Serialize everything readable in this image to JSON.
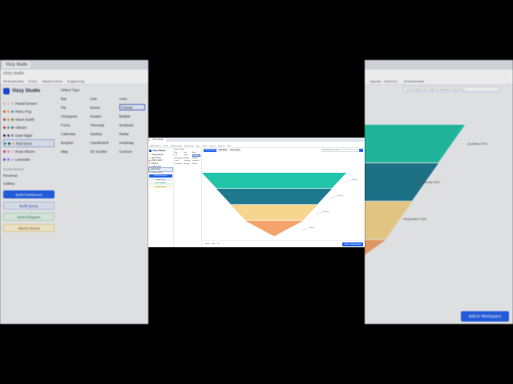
{
  "bg_left": {
    "tabs": [
      "Vizzy Studio"
    ],
    "address": "vizzy studio",
    "bookmarks": [
      "All Bookmarks",
      "El Sur",
      "Student Home",
      "Engineering"
    ],
    "app_name": "Vizzy Studio",
    "palettes": [
      {
        "label": "Pastel Dream",
        "colors": [
          "#f5b5c8",
          "#f7d9a8",
          "#b7e3c4"
        ]
      },
      {
        "label": "Retro Pop",
        "colors": [
          "#e85d4a",
          "#f2b134",
          "#3a9bd9"
        ]
      },
      {
        "label": "Warm Earth",
        "colors": [
          "#a0522d",
          "#d2a36a",
          "#6b8e23"
        ]
      },
      {
        "label": "Vibrant",
        "colors": [
          "#e6194b",
          "#3cb44b",
          "#4363d8"
        ]
      },
      {
        "label": "Dark Night",
        "colors": [
          "#1f2a44",
          "#3b4b73",
          "#7a89b8"
        ]
      },
      {
        "label": "Red Zone",
        "colors": [
          "#2a9d8f",
          "#264653",
          "#e9c46a"
        ]
      },
      {
        "label": "Rose Bloom",
        "colors": [
          "#d6336c",
          "#f783ac",
          "#fcc2d7"
        ]
      },
      {
        "label": "Lavender",
        "colors": [
          "#7048e8",
          "#9775fa",
          "#d0bfff"
        ]
      }
    ],
    "section_label": "WORKSPACE",
    "items": [
      "Revenue",
      "Gallery"
    ],
    "buttons": {
      "build": "Build Dashboard",
      "query": "Build Query",
      "diagram": "Draw Diagram",
      "report": "Sketch Board"
    },
    "controls_title": "Select Type",
    "chart_types": [
      "Bar",
      "Line",
      "Area",
      "Pie",
      "Donut",
      "Funnel",
      "Histogram",
      "Scatter",
      "Bubble",
      "Force",
      "Treemap",
      "Sunburst",
      "Calendar",
      "Sankey",
      "Radar",
      "Boxplot",
      "Candlestick",
      "Heatmap",
      "Map",
      "3D Scatter",
      "Contour"
    ],
    "selected_chart": "Funnel"
  },
  "bg_right": {
    "bookmarks": [
      "Operate - Orders to",
      "All Bookmarks"
    ],
    "search_placeholder": "Ask AI about your data or visualize in any form",
    "add_button": "Add to Workspace"
  },
  "window": {
    "tabs": [
      "Vizzy Studio"
    ],
    "bookmarks": [
      "All Bookmarks",
      "El Sur",
      "Student Home",
      "Engineering",
      "Ops",
      "Orders",
      "Finance",
      "Reports",
      "Team"
    ],
    "app_name": "Vizzy Studio",
    "palettes": [
      {
        "label": "Pastel Dream",
        "colors": [
          "#f5b5c8",
          "#f7d9a8"
        ]
      },
      {
        "label": "Retro Pop",
        "colors": [
          "#e85d4a",
          "#f2b134"
        ]
      },
      {
        "label": "Warm Earth",
        "colors": [
          "#a0522d",
          "#d2a36a"
        ]
      },
      {
        "label": "Vibrant",
        "colors": [
          "#e6194b",
          "#3cb44b"
        ]
      },
      {
        "label": "Dark Night",
        "colors": [
          "#1f2a44",
          "#3b4b73"
        ]
      },
      {
        "label": "Red Zone",
        "colors": [
          "#2a9d8f",
          "#264653"
        ]
      },
      {
        "label": "Rose Bloom",
        "colors": [
          "#d6336c",
          "#f783ac"
        ]
      }
    ],
    "buttons": {
      "build": "Build Dashboard",
      "query": "Build Query",
      "diagram": "Draw Diagram",
      "report": "Sketch Board"
    },
    "controls_title": "Select Type",
    "chart_types": [
      "Bar",
      "Line",
      "Area",
      "Pie",
      "Donut",
      "Funnel",
      "Histogram",
      "Scatter",
      "Bubble",
      "Force",
      "Treemap",
      "Sunburst",
      "Calendar",
      "Sankey",
      "Radar"
    ],
    "selected_chart": "Funnel",
    "toolbar": [
      "Funnel Chart",
      "Edit Data",
      "Insert Chart"
    ],
    "search_placeholder": "Ask AI about your data",
    "bottom": [
      "Zoom",
      "100%",
      "Fit"
    ],
    "add_button": "Add to Workspace"
  },
  "chart_data": {
    "type": "funnel",
    "stages": [
      {
        "name": "Stage 1",
        "value": 100,
        "color": "#22c4a8"
      },
      {
        "name": "Stage 2",
        "value": 80,
        "color": "#1f7a90"
      },
      {
        "name": "Stage 3",
        "value": 60,
        "color": "#f6d58e"
      },
      {
        "name": "Stage 4",
        "value": 40,
        "color": "#f3a36b"
      }
    ]
  },
  "bg_chart": {
    "labels": [
      "Qualified 80%",
      "Opportunity 60%",
      "Negotiation 40%"
    ]
  }
}
